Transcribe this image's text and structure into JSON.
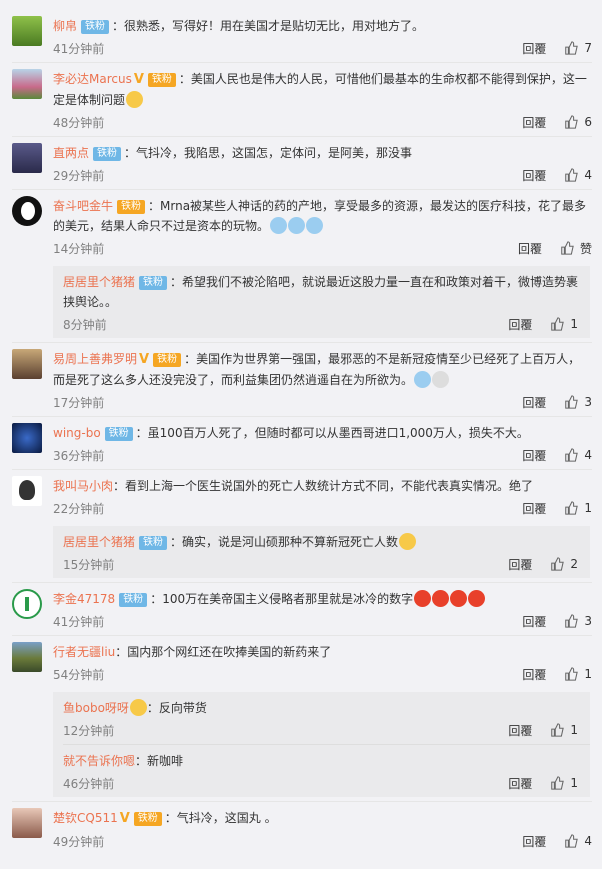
{
  "top": {
    "reply": "回覆",
    "like_icon": "thumb-up-icon"
  },
  "labels": {
    "reply": "回覆",
    "fans_badge": "铁粉"
  },
  "comments": [
    {
      "name": "柳帛",
      "badge": "铁粉",
      "text": "：很熟悉，写得好！用在美国才是贴切无比，用对地方了。",
      "time": "41分钟前",
      "likes": "7"
    },
    {
      "name": "李必达Marcus",
      "badge": "铁粉",
      "text": "：美国人民也是伟大的人民，可惜他们最基本的生命权都不能得到保护，这一定是体制问题",
      "time": "48分钟前",
      "likes": "6"
    },
    {
      "name": "直两点",
      "badge": "铁粉",
      "text": "：气抖冷，我陷思，这国怎，定体问，是阿美，那没事",
      "time": "29分钟前",
      "likes": "4"
    },
    {
      "name": "奋斗吧金牛",
      "badge": "铁粉",
      "text": "：Mrna被某些人神话的药的产地，享受最多的资源，最发达的医疗科技，花了最多的美元，结果人命只不过是资本的玩物。",
      "time": "14分钟前",
      "likes": "赞",
      "replies": [
        {
          "name": "居居里个猪猪",
          "badge": "铁粉",
          "text": "：希望我们不被沦陷吧，就说最近这股力量一直在和政策对着干，微博造势裹挟舆论。。",
          "time": "8分钟前",
          "likes": "1"
        }
      ]
    },
    {
      "name": "易周上善弗罗明",
      "badge": "铁粉",
      "text": "：美国作为世界第一强国，最邪恶的不是新冠疫情至少已经死了上百万人，而是死了这么多人还没完没了，而利益集团仍然逍遥自在为所欲为。",
      "time": "17分钟前",
      "likes": "3"
    },
    {
      "name": "wing-bo",
      "badge": "铁粉",
      "text": "：虽100百万人死了，但随时都可以从墨西哥进口1,000万人，损失不大。",
      "time": "36分钟前",
      "likes": "4"
    },
    {
      "name": "我叫马小肉",
      "text": "：看到上海一个医生说国外的死亡人数统计方式不同，不能代表真实情况。绝了",
      "time": "22分钟前",
      "likes": "1",
      "replies": [
        {
          "name": "居居里个猪猪",
          "badge": "铁粉",
          "text": "：确实，说是河山硕那种不算新冠死亡人数",
          "time": "15分钟前",
          "likes": "2"
        }
      ]
    },
    {
      "name": "李金47178",
      "badge": "铁粉",
      "text": "：100万在美帝国主义侵略者那里就是冰冷的数字",
      "time": "41分钟前",
      "likes": "3"
    },
    {
      "name": "行者无疆liu",
      "text": "：国内那个网红还在吹捧美国的新药来了",
      "time": "54分钟前",
      "likes": "1",
      "replies": [
        {
          "name": "鱼bobo呀呀",
          "text": "：反向带货",
          "time": "12分钟前",
          "likes": "1"
        },
        {
          "name": "就不告诉你嗯",
          "text": "：新咖啡",
          "time": "46分钟前",
          "likes": "1"
        }
      ]
    },
    {
      "name": "楚钦CQ511",
      "badge": "铁粉",
      "text": "：气抖冷，这国丸 。",
      "time": "49分钟前",
      "likes": "4"
    }
  ]
}
